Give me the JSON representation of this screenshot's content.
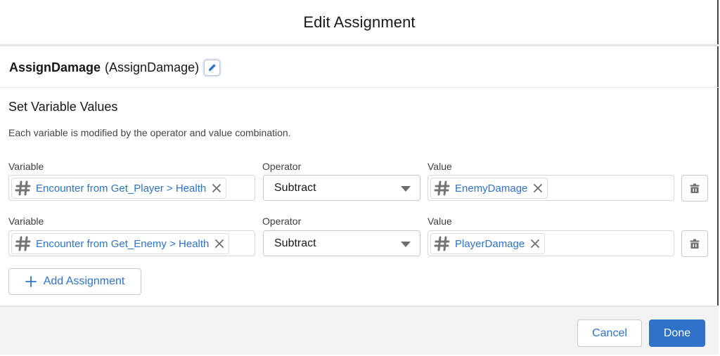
{
  "modal": {
    "title": "Edit Assignment"
  },
  "element": {
    "label": "AssignDamage",
    "api_name": "(AssignDamage)",
    "edit_icon": "pencil-icon"
  },
  "section": {
    "title": "Set Variable Values",
    "description": "Each variable is modified by the operator and value combination."
  },
  "labels": {
    "variable": "Variable",
    "operator": "Operator",
    "value": "Value"
  },
  "assignments": [
    {
      "variable": "Encounter from Get_Player > Health",
      "variable_icon": "hash-icon",
      "operator": "Subtract",
      "value": "EnemyDamage",
      "value_icon": "hash-icon",
      "delete_icon": "trash-icon"
    },
    {
      "variable": "Encounter from Get_Enemy > Health",
      "variable_icon": "hash-icon",
      "operator": "Subtract",
      "value": "PlayerDamage",
      "value_icon": "hash-icon",
      "delete_icon": "trash-icon"
    }
  ],
  "add_button": {
    "label": "Add Assignment",
    "icon": "plus-icon"
  },
  "footer": {
    "cancel_label": "Cancel",
    "done_label": "Done"
  },
  "colors": {
    "brand": "#2e73c9",
    "link_text": "#2e73c9",
    "footer_bg": "#f3f3f3",
    "border": "#c9c9c9"
  }
}
